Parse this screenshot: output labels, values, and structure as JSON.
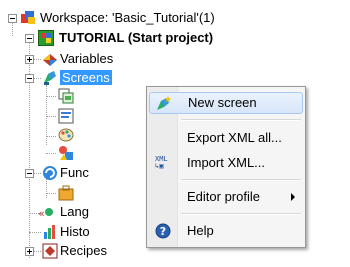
{
  "tree": {
    "workspace_label": "Workspace: 'Basic_Tutorial'(1)",
    "project_label": "TUTORIAL (Start project)",
    "items": {
      "variables": "Variables",
      "screens": "Screens",
      "functions": "Func",
      "languages": "Lang",
      "history": "Histo",
      "recipes": "Recipes"
    }
  },
  "context_menu": {
    "items": [
      {
        "label": "New screen",
        "icon": "new-screen-icon",
        "highlighted": true
      },
      {
        "label": "Export XML all...",
        "icon": ""
      },
      {
        "label": "Import XML...",
        "icon": "xml-icon"
      },
      {
        "label": "Editor profile",
        "icon": "",
        "submenu": true
      },
      {
        "label": "Help",
        "icon": "help-icon"
      }
    ]
  },
  "colors": {
    "selection": "#3399ff",
    "menu_background": "#f5f5f5",
    "highlight_border": "#a9c7ef"
  }
}
